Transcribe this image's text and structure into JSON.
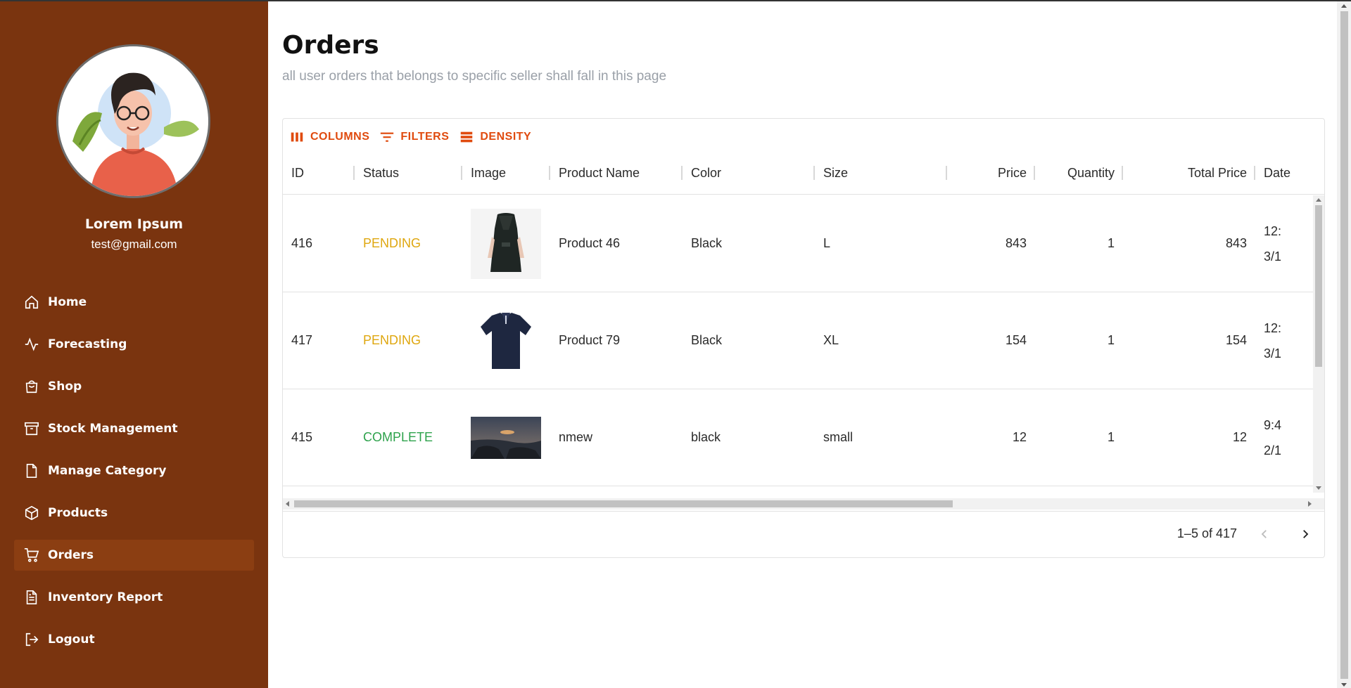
{
  "profile": {
    "name": "Lorem Ipsum",
    "email": "test@gmail.com"
  },
  "nav": [
    {
      "label": "Home",
      "icon": "home-icon",
      "active": false
    },
    {
      "label": "Forecasting",
      "icon": "activity-icon",
      "active": false
    },
    {
      "label": "Shop",
      "icon": "shopping-bag-icon",
      "active": false
    },
    {
      "label": "Stock Management",
      "icon": "archive-icon",
      "active": false
    },
    {
      "label": "Manage Category",
      "icon": "file-icon",
      "active": false
    },
    {
      "label": "Products",
      "icon": "box-icon",
      "active": false
    },
    {
      "label": "Orders",
      "icon": "cart-icon",
      "active": true
    },
    {
      "label": "Inventory Report",
      "icon": "document-icon",
      "active": false
    },
    {
      "label": "Logout",
      "icon": "logout-icon",
      "active": false
    }
  ],
  "page": {
    "title": "Orders",
    "subtitle": "all user orders that belongs to specific seller shall fall in this page"
  },
  "toolbar": {
    "columns": "COLUMNS",
    "filters": "FILTERS",
    "density": "DENSITY"
  },
  "columns": [
    "ID",
    "Status",
    "Image",
    "Product Name",
    "Color",
    "Size",
    "Price",
    "Quantity",
    "Total Price",
    "Date"
  ],
  "rows": [
    {
      "id": "416",
      "status": "PENDING",
      "image": "black-dress-image",
      "product": "Product 46",
      "color": "Black",
      "size": "L",
      "price": "843",
      "quantity": "1",
      "total": "843",
      "date1": "12:",
      "date2": "3/1"
    },
    {
      "id": "417",
      "status": "PENDING",
      "image": "navy-polo-image",
      "product": "Product 79",
      "color": "Black",
      "size": "XL",
      "price": "154",
      "quantity": "1",
      "total": "154",
      "date1": "12:",
      "date2": "3/1"
    },
    {
      "id": "415",
      "status": "COMPLETE",
      "image": "seascape-image",
      "product": "nmew",
      "color": "black",
      "size": "small",
      "price": "12",
      "quantity": "1",
      "total": "12",
      "date1": "9:4",
      "date2": "2/1"
    }
  ],
  "pagination": {
    "range": "1–5 of 417"
  },
  "colors": {
    "sidebar": "#7a340f",
    "active": "#8b3e12",
    "accent": "#e04b0f",
    "pending": "#dfa70f",
    "complete": "#2ea24c"
  }
}
